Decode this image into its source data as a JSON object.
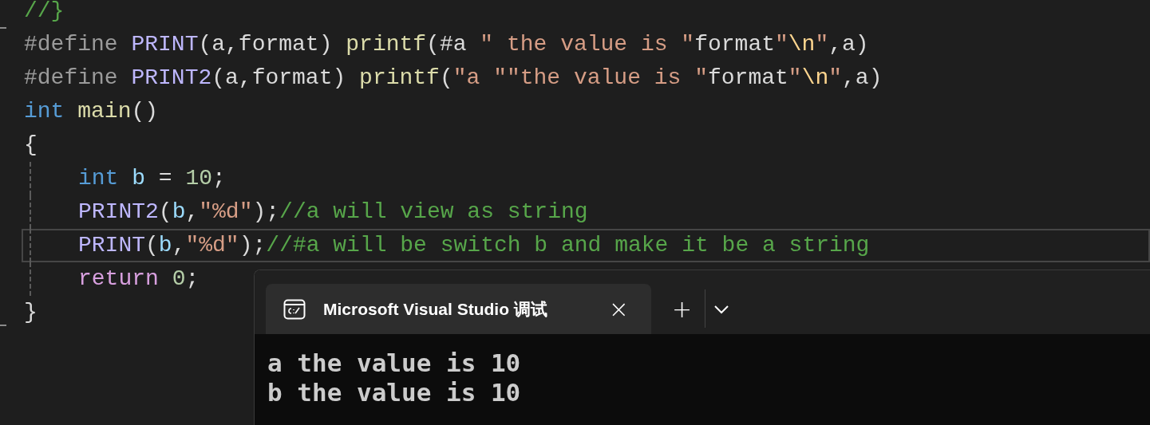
{
  "editor": {
    "lines": [
      {
        "current": false,
        "indent_guide": false,
        "tokens": [
          {
            "kind": "comment",
            "text": "//}"
          }
        ]
      },
      {
        "current": false,
        "indent_guide": false,
        "tokens": [
          {
            "kind": "preproc",
            "text": "#define "
          },
          {
            "kind": "macro",
            "text": "PRINT"
          },
          {
            "kind": "plain",
            "text": "(a,format) "
          },
          {
            "kind": "func",
            "text": "printf"
          },
          {
            "kind": "plain",
            "text": "(#a "
          },
          {
            "kind": "string",
            "text": "\" the value is \""
          },
          {
            "kind": "plain",
            "text": "format"
          },
          {
            "kind": "string",
            "text": "\""
          },
          {
            "kind": "escape",
            "text": "\\n"
          },
          {
            "kind": "string",
            "text": "\""
          },
          {
            "kind": "plain",
            "text": ",a)"
          }
        ]
      },
      {
        "current": false,
        "indent_guide": false,
        "tokens": [
          {
            "kind": "preproc",
            "text": "#define "
          },
          {
            "kind": "macro",
            "text": "PRINT2"
          },
          {
            "kind": "plain",
            "text": "(a,format) "
          },
          {
            "kind": "func",
            "text": "printf"
          },
          {
            "kind": "plain",
            "text": "("
          },
          {
            "kind": "string",
            "text": "\"a \"\"the value is \""
          },
          {
            "kind": "plain",
            "text": "format"
          },
          {
            "kind": "string",
            "text": "\""
          },
          {
            "kind": "escape",
            "text": "\\n"
          },
          {
            "kind": "string",
            "text": "\""
          },
          {
            "kind": "plain",
            "text": ",a)"
          }
        ]
      },
      {
        "current": false,
        "indent_guide": false,
        "tokens": [
          {
            "kind": "keyword",
            "text": "int"
          },
          {
            "kind": "func",
            "text": " main"
          },
          {
            "kind": "plain",
            "text": "()"
          }
        ]
      },
      {
        "current": false,
        "indent_guide": false,
        "tokens": [
          {
            "kind": "plain",
            "text": "{"
          }
        ]
      },
      {
        "current": false,
        "indent_guide": true,
        "tokens": [
          {
            "kind": "keyword",
            "text": "int"
          },
          {
            "kind": "variable",
            "text": " b"
          },
          {
            "kind": "plain",
            "text": " = "
          },
          {
            "kind": "number",
            "text": "10"
          },
          {
            "kind": "plain",
            "text": ";"
          }
        ]
      },
      {
        "current": false,
        "indent_guide": true,
        "tokens": [
          {
            "kind": "macro",
            "text": "PRINT2"
          },
          {
            "kind": "plain",
            "text": "("
          },
          {
            "kind": "variable",
            "text": "b"
          },
          {
            "kind": "plain",
            "text": ","
          },
          {
            "kind": "string",
            "text": "\"%d\""
          },
          {
            "kind": "plain",
            "text": ");"
          },
          {
            "kind": "comment",
            "text": "//a will view as string"
          }
        ]
      },
      {
        "current": true,
        "indent_guide": true,
        "tokens": [
          {
            "kind": "macro",
            "text": "PRINT"
          },
          {
            "kind": "plain",
            "text": "("
          },
          {
            "kind": "variable",
            "text": "b"
          },
          {
            "kind": "plain",
            "text": ","
          },
          {
            "kind": "string",
            "text": "\"%d\""
          },
          {
            "kind": "plain",
            "text": ");"
          },
          {
            "kind": "comment",
            "text": "//#a will be switch b and make it be a string"
          }
        ]
      },
      {
        "current": false,
        "indent_guide": true,
        "tokens": [
          {
            "kind": "control",
            "text": "return"
          },
          {
            "kind": "number",
            "text": " 0"
          },
          {
            "kind": "plain",
            "text": ";"
          }
        ]
      },
      {
        "current": false,
        "indent_guide": false,
        "tokens": [
          {
            "kind": "plain",
            "text": "}"
          }
        ]
      }
    ]
  },
  "terminal": {
    "tab": {
      "title": "Microsoft Visual Studio 调试",
      "close": "×",
      "selected": true
    },
    "new_tab": "+",
    "output": [
      "a the value is 10",
      "b the value is 10"
    ]
  }
}
